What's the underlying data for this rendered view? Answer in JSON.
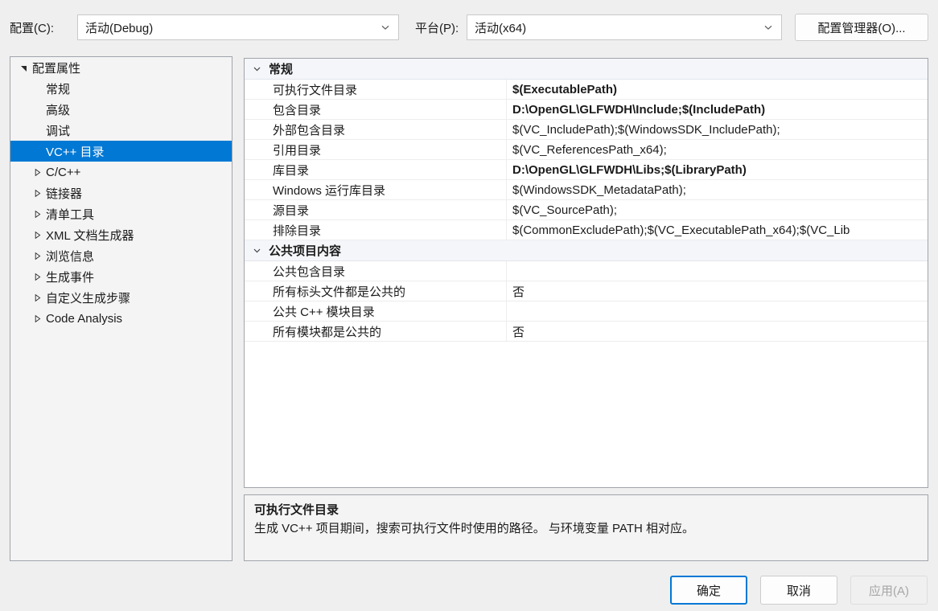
{
  "toolbar": {
    "config_label": "配置(C):",
    "config_value": "活动(Debug)",
    "platform_label": "平台(P):",
    "platform_value": "活动(x64)",
    "config_manager_label": "配置管理器(O)..."
  },
  "tree": {
    "items": [
      {
        "label": "配置属性",
        "level": 0,
        "expander": "expanded",
        "selected": false
      },
      {
        "label": "常规",
        "level": 1,
        "expander": "none",
        "selected": false
      },
      {
        "label": "高级",
        "level": 1,
        "expander": "none",
        "selected": false
      },
      {
        "label": "调试",
        "level": 1,
        "expander": "none",
        "selected": false
      },
      {
        "label": "VC++ 目录",
        "level": 1,
        "expander": "none",
        "selected": true
      },
      {
        "label": "C/C++",
        "level": 1,
        "expander": "collapsed",
        "selected": false
      },
      {
        "label": "链接器",
        "level": 1,
        "expander": "collapsed",
        "selected": false
      },
      {
        "label": "清单工具",
        "level": 1,
        "expander": "collapsed",
        "selected": false
      },
      {
        "label": "XML 文档生成器",
        "level": 1,
        "expander": "collapsed",
        "selected": false
      },
      {
        "label": "浏览信息",
        "level": 1,
        "expander": "collapsed",
        "selected": false
      },
      {
        "label": "生成事件",
        "level": 1,
        "expander": "collapsed",
        "selected": false
      },
      {
        "label": "自定义生成步骤",
        "level": 1,
        "expander": "collapsed",
        "selected": false
      },
      {
        "label": "Code Analysis",
        "level": 1,
        "expander": "collapsed",
        "selected": false
      }
    ]
  },
  "grid": {
    "sections": [
      {
        "title": "常规",
        "expanded": true,
        "rows": [
          {
            "name": "可执行文件目录",
            "value": "$(ExecutablePath)",
            "modified": true
          },
          {
            "name": "包含目录",
            "value": "D:\\OpenGL\\GLFWDH\\Include;$(IncludePath)",
            "modified": true
          },
          {
            "name": "外部包含目录",
            "value": "$(VC_IncludePath);$(WindowsSDK_IncludePath);",
            "modified": false
          },
          {
            "name": "引用目录",
            "value": "$(VC_ReferencesPath_x64);",
            "modified": false
          },
          {
            "name": "库目录",
            "value": "D:\\OpenGL\\GLFWDH\\Libs;$(LibraryPath)",
            "modified": true
          },
          {
            "name": "Windows 运行库目录",
            "value": "$(WindowsSDK_MetadataPath);",
            "modified": false
          },
          {
            "name": "源目录",
            "value": "$(VC_SourcePath);",
            "modified": false
          },
          {
            "name": "排除目录",
            "value": "$(CommonExcludePath);$(VC_ExecutablePath_x64);$(VC_Lib",
            "modified": false
          }
        ]
      },
      {
        "title": "公共项目内容",
        "expanded": true,
        "rows": [
          {
            "name": "公共包含目录",
            "value": "",
            "modified": false
          },
          {
            "name": "所有标头文件都是公共的",
            "value": "否",
            "modified": false
          },
          {
            "name": "公共 C++ 模块目录",
            "value": "",
            "modified": false
          },
          {
            "name": "所有模块都是公共的",
            "value": "否",
            "modified": false
          }
        ]
      }
    ]
  },
  "description": {
    "title": "可执行文件目录",
    "body": "生成 VC++ 项目期间，搜索可执行文件时使用的路径。 与环境变量 PATH 相对应。"
  },
  "footer": {
    "ok_label": "确定",
    "cancel_label": "取消",
    "apply_label": "应用(A)"
  },
  "colors": {
    "selection": "#0078D4",
    "dialog_bg": "#EFEFEF",
    "panel_bg": "#F4F4F4",
    "grid_bg": "#FFFFFF",
    "category_bg": "#F4F6FA"
  }
}
